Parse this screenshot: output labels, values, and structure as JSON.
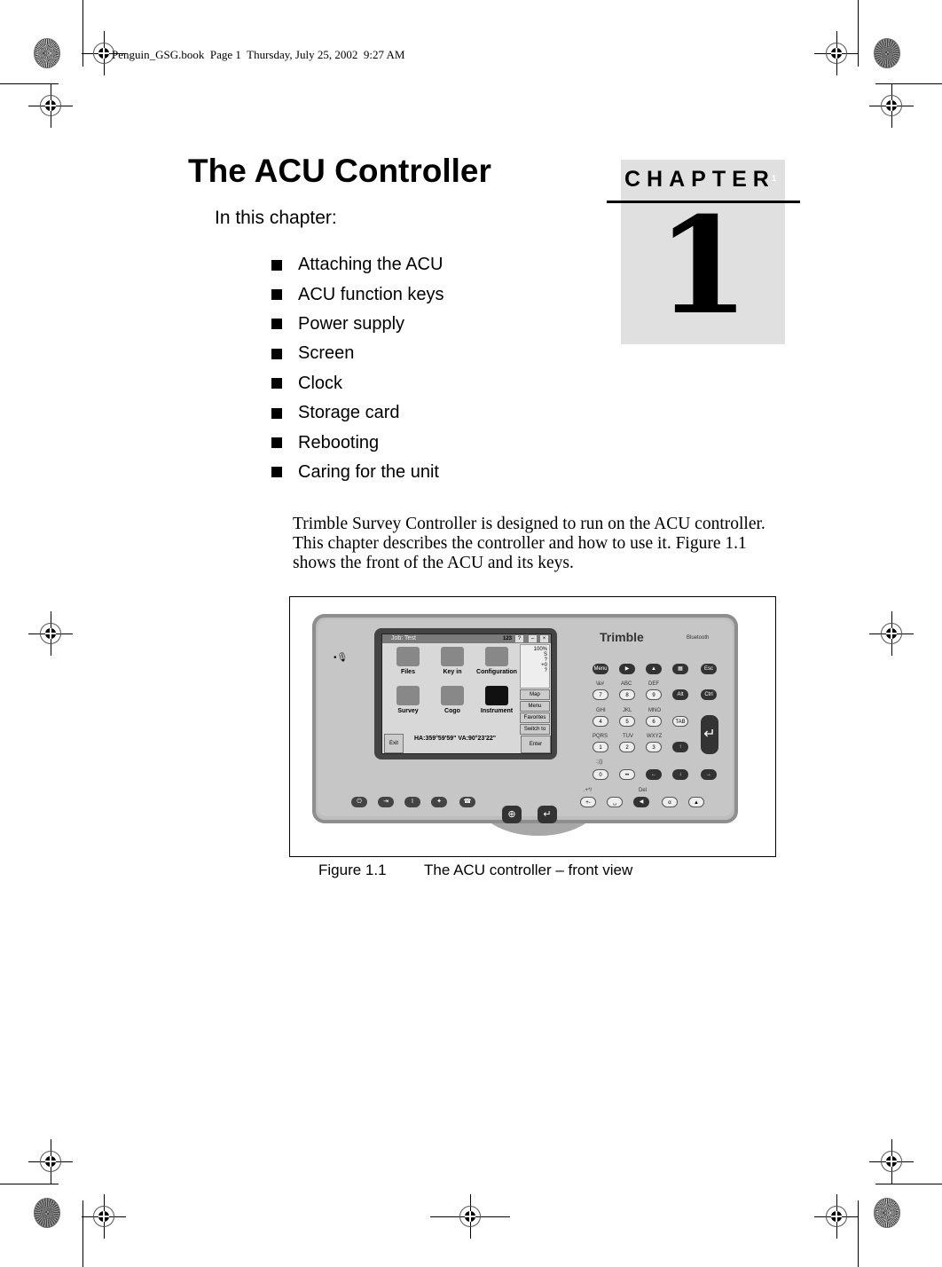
{
  "slug": "Penguin_GSG.book  Page 1  Thursday, July 25, 2002  9:27 AM",
  "chapter": {
    "word": "CHAPTER",
    "superscript": "1",
    "number": "1",
    "title": "The ACU Controller",
    "intro": "In this chapter:",
    "topics": [
      "Attaching the ACU",
      "ACU function keys",
      "Power supply",
      "Screen",
      "Clock",
      "Storage card",
      "Rebooting",
      "Caring for the unit"
    ]
  },
  "body_paragraph": "Trimble Survey Controller is designed to run on the ACU controller. This chapter describes the controller and how to use it. Figure 1.1 shows the front of the ACU and its keys.",
  "figure": {
    "label": "Figure 1.1",
    "caption": "The ACU controller – front view",
    "device": {
      "brand": "Trimble",
      "bluetooth": "Bluetooth",
      "screen": {
        "title": "Job: Test",
        "input_mode": "123",
        "title_buttons": [
          "?",
          "–",
          "×"
        ],
        "apps": [
          "Files",
          "Key in",
          "Configuration",
          "Survey",
          "Cogo",
          "Instrument"
        ],
        "status": [
          "100%",
          "S",
          "?",
          "+0",
          "?"
        ],
        "side_buttons": [
          "Map",
          "Menu",
          "Favorites",
          "Switch to"
        ],
        "readout": "HA:359°59'59\"   VA:90°23'22\"",
        "exit": "Exit",
        "enter": "Enter"
      },
      "keypad": {
        "top_row": [
          "Menu",
          "▶",
          "▲",
          "▦",
          "Esc"
        ],
        "row_labels_1": [
          "\\&#",
          "ABC",
          "DEF"
        ],
        "row1": [
          "7",
          "8",
          "9",
          "Alt",
          "Ctrl"
        ],
        "row_labels_2": [
          "GHI",
          "JKL",
          "MNO"
        ],
        "row2": [
          "4",
          "5",
          "6",
          "TAB"
        ],
        "row_labels_3": [
          "PQRS",
          "TUV",
          "WXYZ"
        ],
        "row3": [
          "1",
          "2",
          "3",
          "↑"
        ],
        "row_labels_4": [
          ":;()"
        ],
        "row4": [
          "0",
          "••",
          "←",
          "↓",
          "→"
        ],
        "row_labels_5": [
          ".+*/",
          "Del"
        ],
        "row5": [
          "+-",
          "␣",
          "◀",
          "α",
          "▲"
        ],
        "enter_symbol": "↵",
        "function_keys": [
          "⏻",
          "⇥",
          "I",
          "✦",
          "☎"
        ],
        "center_keys": [
          "⊕",
          "↵"
        ]
      }
    }
  }
}
